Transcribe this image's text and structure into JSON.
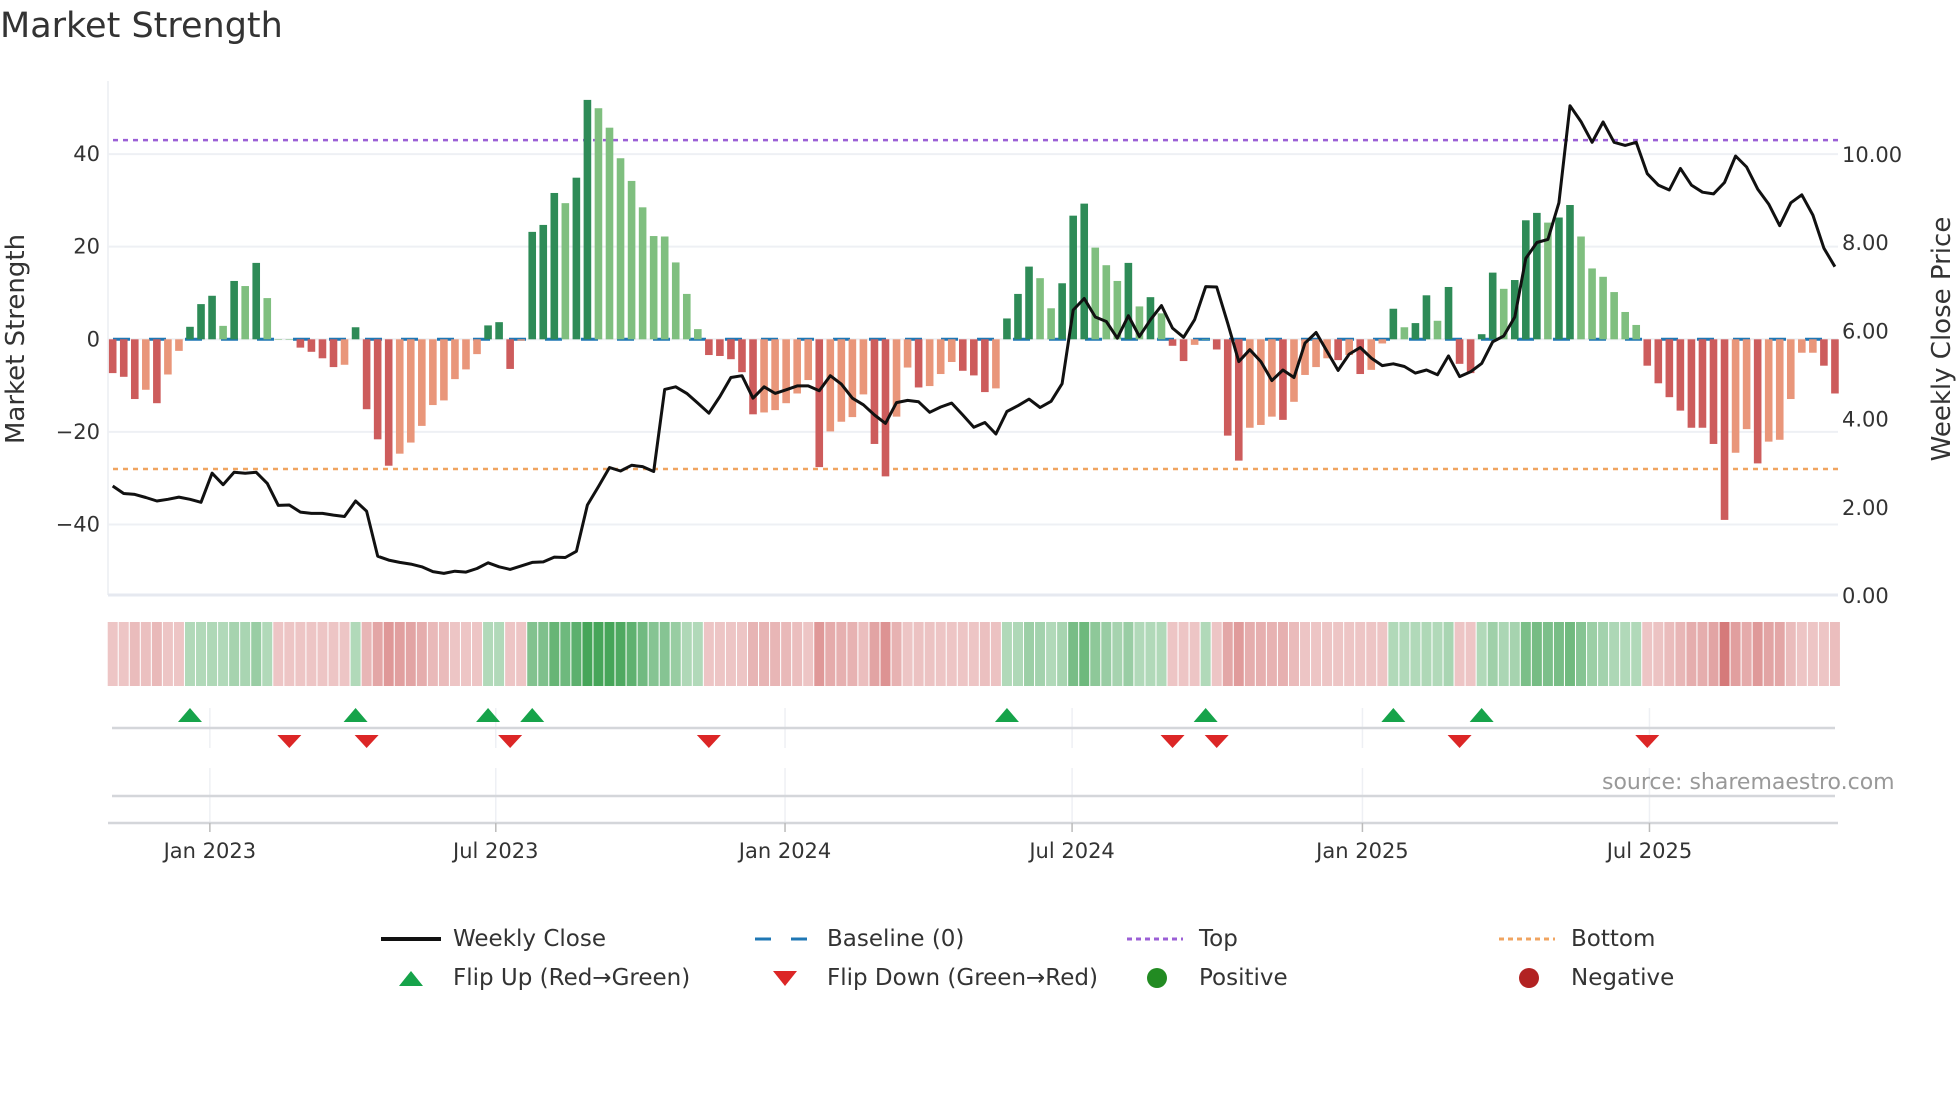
{
  "title": "Market Strength",
  "source": "source: sharemaestro.com",
  "colors": {
    "strong_pos": "#2e8b57",
    "weak_pos": "#7fbf7f",
    "strong_neg": "#cd5c5c",
    "weak_neg": "#e9967a",
    "line": "#111111",
    "baseline": "#1f77b4",
    "top": "#9b5fd6",
    "bottom": "#f0a460",
    "flip_up": "#16a34a",
    "flip_down": "#dc2626",
    "positive": "#228b22",
    "negative": "#b22222"
  },
  "legend": [
    {
      "label": "Weekly Close",
      "kind": "line"
    },
    {
      "label": "Baseline (0)",
      "kind": "baseline"
    },
    {
      "label": "Top",
      "kind": "top"
    },
    {
      "label": "Bottom",
      "kind": "bottom"
    },
    {
      "label": "Flip Up (Red→Green)",
      "kind": "flip_up"
    },
    {
      "label": "Flip Down (Green→Red)",
      "kind": "flip_down"
    },
    {
      "label": "Positive",
      "kind": "positive"
    },
    {
      "label": "Negative",
      "kind": "negative"
    }
  ],
  "chart_data": {
    "type": "bar",
    "title": "Market Strength",
    "ylabel": "Market Strength",
    "y2label": "Weekly Close Price",
    "ylim": [
      -55.5,
      55.5
    ],
    "y2lim": [
      0,
      11.65
    ],
    "yticks": [
      40,
      20,
      0,
      -20,
      -40
    ],
    "ytick_labels": [
      "40",
      "20",
      "0",
      "−20",
      "−40"
    ],
    "y2ticks": [
      0,
      2,
      4,
      6,
      8,
      10
    ],
    "y2tick_labels": [
      "0.00",
      "2.00",
      "4.00",
      "6.00",
      "8.00",
      "10.00"
    ],
    "x_unit": "week index",
    "xticks": [
      8.8,
      34.7,
      60.9,
      86.9,
      113.2,
      139.2
    ],
    "xtick_labels": [
      "Jan 2023",
      "Jul 2023",
      "Jan 2024",
      "Jul 2024",
      "Jan 2025",
      "Jul 2025"
    ],
    "top_level": 43,
    "bottom_level": -28,
    "baseline": 0,
    "strength": [
      -7.3,
      -8.1,
      -12.9,
      -10.9,
      -13.8,
      -7.6,
      -2.5,
      2.7,
      7.6,
      9.4,
      2.9,
      12.6,
      11.5,
      16.5,
      8.9,
      0,
      0,
      -1.8,
      -2.7,
      -4.1,
      -6.0,
      -5.5,
      2.6,
      -15.1,
      -21.6,
      -27.3,
      -24.7,
      -22.3,
      -18.7,
      -14.2,
      -13.2,
      -8.6,
      -6.5,
      -3.2,
      3.0,
      3.7,
      -6.4,
      -0.3,
      23.2,
      24.7,
      31.6,
      29.4,
      34.9,
      51.7,
      49.9,
      45.7,
      39.1,
      34.2,
      28.5,
      22.3,
      22.2,
      16.6,
      9.8,
      2.2,
      -3.4,
      -3.6,
      -4.3,
      -7.1,
      -16.2,
      -15.8,
      -15.3,
      -13.8,
      -11.7,
      -8.8,
      -27.6,
      -19.9,
      -17.8,
      -16.8,
      -11.9,
      -22.6,
      -29.6,
      -16.7,
      -6.1,
      -10.4,
      -10.1,
      -7.5,
      -4.9,
      -6.8,
      -7.8,
      -11.4,
      -10.6,
      4.5,
      9.8,
      15.7,
      13.2,
      6.7,
      12.1,
      26.7,
      29.3,
      19.8,
      16.0,
      12.6,
      16.5,
      7.1,
      9.1,
      5.6,
      -1.4,
      -4.7,
      -1.2,
      0,
      -2.2,
      -20.8,
      -26.2,
      -19.1,
      -18.5,
      -16.7,
      -17.4,
      -13.5,
      -7.7,
      -6.0,
      -4.1,
      -4.5,
      -3.4,
      -7.5,
      -6.6,
      -0.9,
      6.6,
      2.6,
      3.5,
      9.5,
      4.0,
      11.3,
      -5.3,
      -7.3,
      1.1,
      14.4,
      10.9,
      12.8,
      25.7,
      27.3,
      25.2,
      26.3,
      29.0,
      22.2,
      15.3,
      13.5,
      10.2,
      5.9,
      3.1,
      -5.7,
      -9.5,
      -12.5,
      -15.4,
      -19.1,
      -19.1,
      -22.6,
      -39.0,
      -24.5,
      -19.4,
      -26.8,
      -22.1,
      -21.7,
      -12.9,
      -2.9,
      -2.9,
      -5.7,
      -11.7
    ],
    "strong": [
      1,
      1,
      1,
      0,
      1,
      0,
      0,
      1,
      1,
      1,
      0,
      1,
      0,
      1,
      0,
      0,
      0,
      1,
      1,
      1,
      1,
      0,
      1,
      1,
      1,
      1,
      0,
      0,
      0,
      0,
      0,
      0,
      0,
      0,
      1,
      1,
      1,
      0,
      1,
      1,
      1,
      0,
      1,
      1,
      0,
      0,
      0,
      0,
      0,
      0,
      0,
      0,
      0,
      0,
      1,
      1,
      1,
      1,
      1,
      0,
      0,
      0,
      0,
      0,
      1,
      0,
      0,
      0,
      0,
      1,
      1,
      0,
      0,
      1,
      0,
      0,
      0,
      1,
      1,
      1,
      0,
      1,
      1,
      1,
      0,
      0,
      1,
      1,
      1,
      0,
      0,
      0,
      1,
      0,
      1,
      0,
      1,
      1,
      0,
      0,
      1,
      1,
      1,
      0,
      0,
      0,
      1,
      0,
      0,
      0,
      0,
      1,
      0,
      1,
      0,
      0,
      1,
      0,
      1,
      1,
      0,
      1,
      1,
      1,
      1,
      1,
      0,
      1,
      1,
      1,
      0,
      1,
      1,
      0,
      0,
      0,
      0,
      0,
      0,
      1,
      1,
      1,
      1,
      1,
      1,
      1,
      1,
      0,
      0,
      1,
      0,
      0,
      0,
      0,
      0,
      1,
      1
    ],
    "weekly_close": [
      2.47,
      2.3,
      2.28,
      2.21,
      2.13,
      2.17,
      2.22,
      2.17,
      2.1,
      2.76,
      2.5,
      2.78,
      2.76,
      2.78,
      2.53,
      2.03,
      2.04,
      1.88,
      1.85,
      1.85,
      1.81,
      1.78,
      2.13,
      1.9,
      0.88,
      0.79,
      0.74,
      0.7,
      0.64,
      0.53,
      0.49,
      0.54,
      0.52,
      0.6,
      0.73,
      0.64,
      0.58,
      0.66,
      0.74,
      0.75,
      0.86,
      0.85,
      0.99,
      2.04,
      2.46,
      2.89,
      2.81,
      2.94,
      2.91,
      2.8,
      4.66,
      4.72,
      4.57,
      4.35,
      4.12,
      4.5,
      4.93,
      4.97,
      4.46,
      4.72,
      4.57,
      4.65,
      4.74,
      4.74,
      4.63,
      4.97,
      4.78,
      4.46,
      4.31,
      4.08,
      3.89,
      4.36,
      4.41,
      4.38,
      4.14,
      4.26,
      4.35,
      4.08,
      3.8,
      3.91,
      3.65,
      4.16,
      4.29,
      4.44,
      4.25,
      4.39,
      4.79,
      6.46,
      6.72,
      6.3,
      6.2,
      5.82,
      6.33,
      5.86,
      6.24,
      6.56,
      6.05,
      5.84,
      6.24,
      6.99,
      6.98,
      6.16,
      5.29,
      5.56,
      5.29,
      4.86,
      5.1,
      4.93,
      5.71,
      5.95,
      5.52,
      5.09,
      5.46,
      5.61,
      5.37,
      5.2,
      5.24,
      5.18,
      5.03,
      5.1,
      4.99,
      5.42,
      4.95,
      5.06,
      5.25,
      5.74,
      5.87,
      6.3,
      7.63,
      7.99,
      8.06,
      8.89,
      11.09,
      10.73,
      10.26,
      10.72,
      10.26,
      10.19,
      10.26,
      9.55,
      9.29,
      9.18,
      9.67,
      9.29,
      9.13,
      9.09,
      9.35,
      9.95,
      9.7,
      9.2,
      8.86,
      8.37,
      8.89,
      9.07,
      8.61,
      7.86,
      7.44
    ],
    "flip_up_weeks": [
      7,
      22,
      34,
      38,
      81,
      99,
      116,
      124
    ],
    "flip_down_weeks": [
      16,
      23,
      36,
      54,
      96,
      100,
      122,
      139
    ],
    "legend_placement": "bottom-center"
  }
}
